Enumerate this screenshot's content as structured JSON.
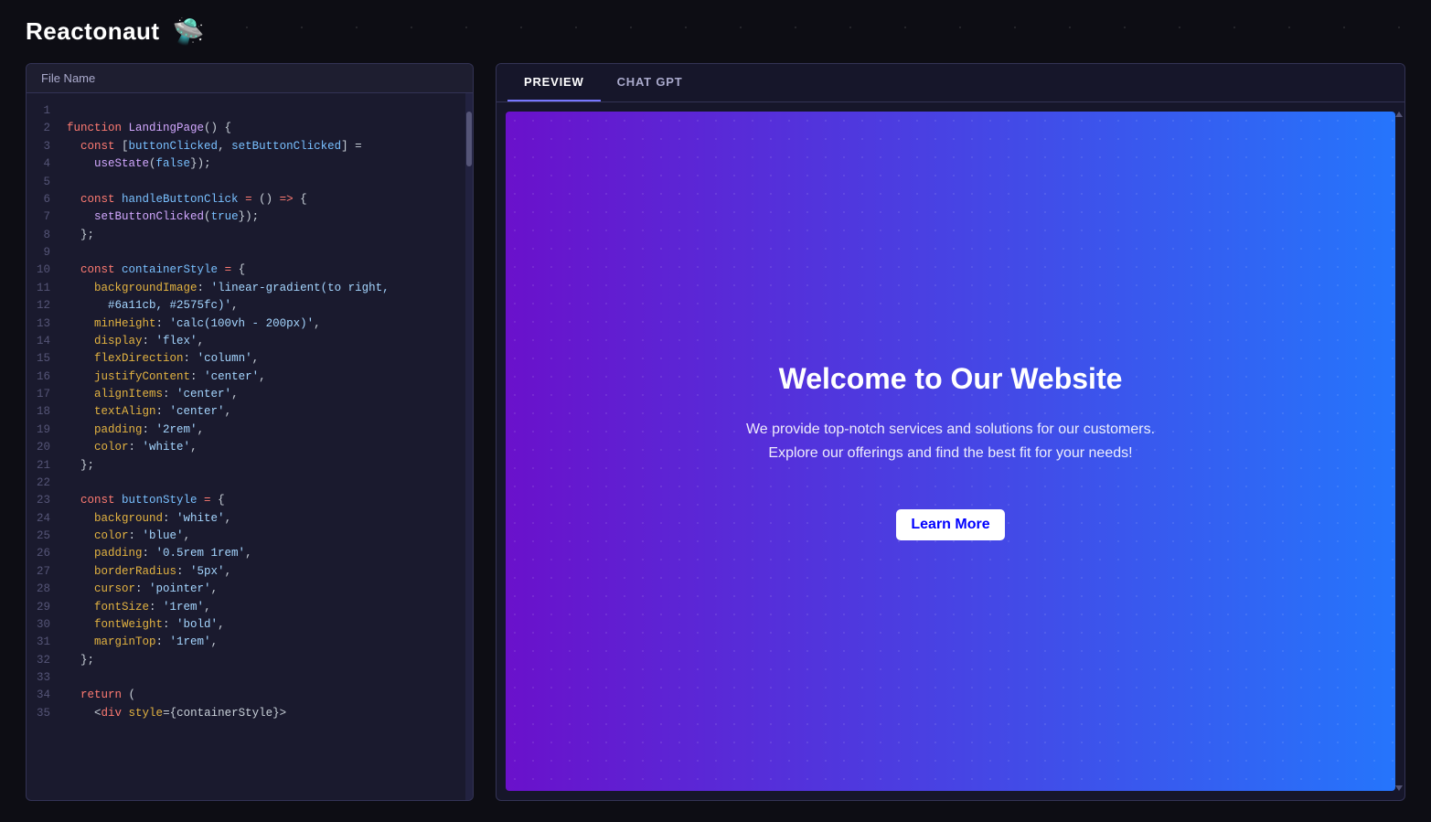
{
  "app": {
    "title": "Reactonaut",
    "planet_icon": "🛸"
  },
  "tabs": {
    "preview": {
      "label": "PREVIEW",
      "active": true
    },
    "chatgpt": {
      "label": "CHAT GPT",
      "active": false
    }
  },
  "code_panel": {
    "header": "File Name",
    "lines": [
      {
        "num": 1,
        "content": ""
      },
      {
        "num": 2,
        "tokens": [
          {
            "t": "kw",
            "v": "function "
          },
          {
            "t": "fn",
            "v": "LandingPage"
          },
          {
            "t": "punc",
            "v": "() {"
          }
        ]
      },
      {
        "num": 3,
        "tokens": [
          {
            "t": "indent",
            "v": "  "
          },
          {
            "t": "kw",
            "v": "const "
          },
          {
            "t": "punc",
            "v": "["
          },
          {
            "t": "var",
            "v": "buttonClicked"
          },
          {
            "t": "punc",
            "v": ", "
          },
          {
            "t": "var",
            "v": "setButtonClicked"
          },
          {
            "t": "punc",
            "v": "] ="
          }
        ]
      },
      {
        "num": 4,
        "tokens": [
          {
            "t": "indent",
            "v": "    "
          },
          {
            "t": "fn",
            "v": "useState"
          },
          {
            "t": "punc",
            "v": "("
          },
          {
            "t": "bool",
            "v": "false"
          },
          {
            "t": "punc",
            "v": "});"
          }
        ]
      },
      {
        "num": 5,
        "content": ""
      },
      {
        "num": 6,
        "tokens": [
          {
            "t": "indent",
            "v": "  "
          },
          {
            "t": "kw",
            "v": "const "
          },
          {
            "t": "var",
            "v": "handleButtonClick "
          },
          {
            "t": "op",
            "v": "="
          },
          {
            "t": "punc",
            "v": " () "
          },
          {
            "t": "arrow",
            "v": "=>"
          },
          {
            "t": "punc",
            "v": " {"
          }
        ]
      },
      {
        "num": 7,
        "tokens": [
          {
            "t": "indent",
            "v": "    "
          },
          {
            "t": "fn",
            "v": "setButtonClicked"
          },
          {
            "t": "punc",
            "v": "("
          },
          {
            "t": "bool",
            "v": "true"
          },
          {
            "t": "punc",
            "v": "});"
          }
        ]
      },
      {
        "num": 8,
        "tokens": [
          {
            "t": "indent",
            "v": "  "
          },
          {
            "t": "punc",
            "v": "};"
          }
        ]
      },
      {
        "num": 9,
        "content": ""
      },
      {
        "num": 10,
        "tokens": [
          {
            "t": "indent",
            "v": "  "
          },
          {
            "t": "kw",
            "v": "const "
          },
          {
            "t": "var",
            "v": "containerStyle "
          },
          {
            "t": "op",
            "v": "="
          },
          {
            "t": "punc",
            "v": " {"
          }
        ]
      },
      {
        "num": 11,
        "tokens": [
          {
            "t": "indent",
            "v": "    "
          },
          {
            "t": "prop",
            "v": "backgroundImage"
          },
          {
            "t": "punc",
            "v": ": "
          },
          {
            "t": "str",
            "v": "'linear-gradient(to right,"
          }
        ]
      },
      {
        "num": 12,
        "tokens": [
          {
            "t": "indent",
            "v": "      "
          },
          {
            "t": "str",
            "v": "#6a11cb, #2575fc)'"
          },
          {
            "t": "punc",
            "v": ","
          }
        ]
      },
      {
        "num": 13,
        "tokens": [
          {
            "t": "indent",
            "v": "    "
          },
          {
            "t": "prop",
            "v": "minHeight"
          },
          {
            "t": "punc",
            "v": ": "
          },
          {
            "t": "str",
            "v": "'calc(100vh - 200px)'"
          },
          {
            "t": "punc",
            "v": ","
          }
        ]
      },
      {
        "num": 14,
        "tokens": [
          {
            "t": "indent",
            "v": "    "
          },
          {
            "t": "prop",
            "v": "display"
          },
          {
            "t": "punc",
            "v": ": "
          },
          {
            "t": "str",
            "v": "'flex'"
          },
          {
            "t": "punc",
            "v": ","
          }
        ]
      },
      {
        "num": 15,
        "tokens": [
          {
            "t": "indent",
            "v": "    "
          },
          {
            "t": "prop",
            "v": "flexDirection"
          },
          {
            "t": "punc",
            "v": ": "
          },
          {
            "t": "str",
            "v": "'column'"
          },
          {
            "t": "punc",
            "v": ","
          }
        ]
      },
      {
        "num": 16,
        "tokens": [
          {
            "t": "indent",
            "v": "    "
          },
          {
            "t": "prop",
            "v": "justifyContent"
          },
          {
            "t": "punc",
            "v": ": "
          },
          {
            "t": "str",
            "v": "'center'"
          },
          {
            "t": "punc",
            "v": ","
          }
        ]
      },
      {
        "num": 17,
        "tokens": [
          {
            "t": "indent",
            "v": "    "
          },
          {
            "t": "prop",
            "v": "alignItems"
          },
          {
            "t": "punc",
            "v": ": "
          },
          {
            "t": "str",
            "v": "'center'"
          },
          {
            "t": "punc",
            "v": ","
          }
        ]
      },
      {
        "num": 18,
        "tokens": [
          {
            "t": "indent",
            "v": "    "
          },
          {
            "t": "prop",
            "v": "textAlign"
          },
          {
            "t": "punc",
            "v": ": "
          },
          {
            "t": "str",
            "v": "'center'"
          },
          {
            "t": "punc",
            "v": ","
          }
        ]
      },
      {
        "num": 19,
        "tokens": [
          {
            "t": "indent",
            "v": "    "
          },
          {
            "t": "prop",
            "v": "padding"
          },
          {
            "t": "punc",
            "v": ": "
          },
          {
            "t": "str",
            "v": "'2rem'"
          },
          {
            "t": "punc",
            "v": ","
          }
        ]
      },
      {
        "num": 20,
        "tokens": [
          {
            "t": "indent",
            "v": "    "
          },
          {
            "t": "prop",
            "v": "color"
          },
          {
            "t": "punc",
            "v": ": "
          },
          {
            "t": "str",
            "v": "'white'"
          },
          {
            "t": "punc",
            "v": ","
          }
        ]
      },
      {
        "num": 21,
        "tokens": [
          {
            "t": "indent",
            "v": "  "
          },
          {
            "t": "punc",
            "v": "};"
          }
        ]
      },
      {
        "num": 22,
        "content": ""
      },
      {
        "num": 23,
        "tokens": [
          {
            "t": "indent",
            "v": "  "
          },
          {
            "t": "kw",
            "v": "const "
          },
          {
            "t": "var",
            "v": "buttonStyle "
          },
          {
            "t": "op",
            "v": "="
          },
          {
            "t": "punc",
            "v": " {"
          }
        ]
      },
      {
        "num": 24,
        "tokens": [
          {
            "t": "indent",
            "v": "    "
          },
          {
            "t": "prop",
            "v": "background"
          },
          {
            "t": "punc",
            "v": ": "
          },
          {
            "t": "str",
            "v": "'white'"
          },
          {
            "t": "punc",
            "v": ","
          }
        ]
      },
      {
        "num": 25,
        "tokens": [
          {
            "t": "indent",
            "v": "    "
          },
          {
            "t": "prop",
            "v": "color"
          },
          {
            "t": "punc",
            "v": ": "
          },
          {
            "t": "str",
            "v": "'blue'"
          },
          {
            "t": "punc",
            "v": ","
          }
        ]
      },
      {
        "num": 26,
        "tokens": [
          {
            "t": "indent",
            "v": "    "
          },
          {
            "t": "prop",
            "v": "padding"
          },
          {
            "t": "punc",
            "v": ": "
          },
          {
            "t": "str",
            "v": "'0.5rem 1rem'"
          },
          {
            "t": "punc",
            "v": ","
          }
        ]
      },
      {
        "num": 27,
        "tokens": [
          {
            "t": "indent",
            "v": "    "
          },
          {
            "t": "prop",
            "v": "borderRadius"
          },
          {
            "t": "punc",
            "v": ": "
          },
          {
            "t": "str",
            "v": "'5px'"
          },
          {
            "t": "punc",
            "v": ","
          }
        ]
      },
      {
        "num": 28,
        "tokens": [
          {
            "t": "indent",
            "v": "    "
          },
          {
            "t": "prop",
            "v": "cursor"
          },
          {
            "t": "punc",
            "v": ": "
          },
          {
            "t": "str",
            "v": "'pointer'"
          },
          {
            "t": "punc",
            "v": ","
          }
        ]
      },
      {
        "num": 29,
        "tokens": [
          {
            "t": "indent",
            "v": "    "
          },
          {
            "t": "prop",
            "v": "fontSize"
          },
          {
            "t": "punc",
            "v": ": "
          },
          {
            "t": "str",
            "v": "'1rem'"
          },
          {
            "t": "punc",
            "v": ","
          }
        ]
      },
      {
        "num": 30,
        "tokens": [
          {
            "t": "indent",
            "v": "    "
          },
          {
            "t": "prop",
            "v": "fontWeight"
          },
          {
            "t": "punc",
            "v": ": "
          },
          {
            "t": "str",
            "v": "'bold'"
          },
          {
            "t": "punc",
            "v": ","
          }
        ]
      },
      {
        "num": 31,
        "tokens": [
          {
            "t": "indent",
            "v": "    "
          },
          {
            "t": "prop",
            "v": "marginTop"
          },
          {
            "t": "punc",
            "v": ": "
          },
          {
            "t": "str",
            "v": "'1rem'"
          },
          {
            "t": "punc",
            "v": ","
          }
        ]
      },
      {
        "num": 32,
        "tokens": [
          {
            "t": "indent",
            "v": "  "
          },
          {
            "t": "punc",
            "v": "};"
          }
        ]
      },
      {
        "num": 33,
        "content": ""
      },
      {
        "num": 34,
        "tokens": [
          {
            "t": "indent",
            "v": "  "
          },
          {
            "t": "kw",
            "v": "return "
          },
          {
            "t": "punc",
            "v": "("
          }
        ]
      },
      {
        "num": 35,
        "tokens": [
          {
            "t": "indent",
            "v": "    "
          },
          {
            "t": "punc",
            "v": "<"
          },
          {
            "t": "kw",
            "v": "div "
          },
          {
            "t": "prop",
            "v": "style"
          },
          {
            "t": "punc",
            "v": "={containerStyle}>"
          }
        ]
      }
    ]
  },
  "preview": {
    "title": "Welcome to Our Website",
    "subtitle": "We provide top-notch services and solutions for our customers. Explore our offerings and find the best fit for your needs!",
    "button_label": "Learn More"
  }
}
